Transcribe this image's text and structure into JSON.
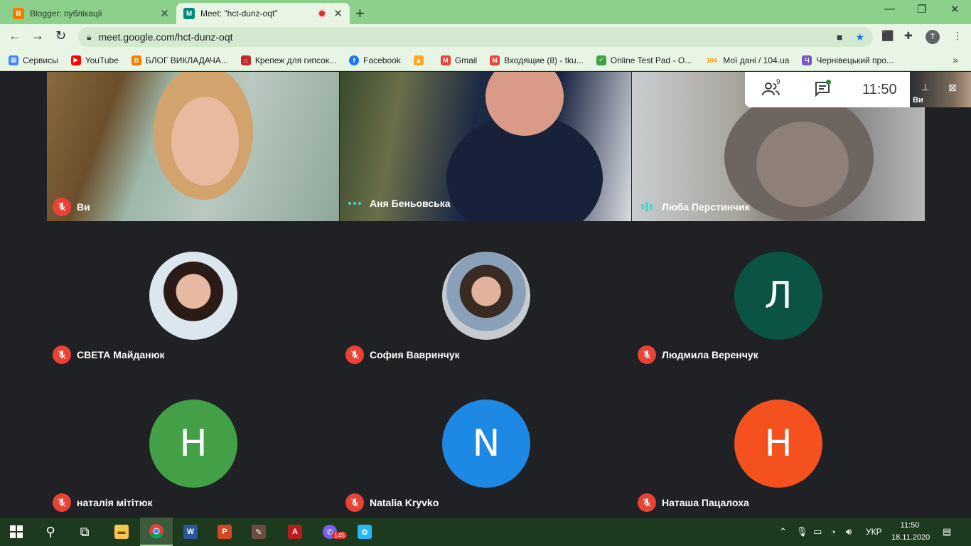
{
  "browser": {
    "tabs": [
      {
        "title": "Blogger: публікації",
        "favicon": "B",
        "color": "#f57c00"
      },
      {
        "title": "Meet: \"hct-dunz-oqt\"",
        "favicon": "M",
        "color": "#00897b"
      }
    ],
    "url": "meet.google.com/hct-dunz-oqt",
    "profile_initial": "T"
  },
  "bookmarks": [
    {
      "label": "Сервисы",
      "icon": "apps-grid-icon",
      "color": "#4285f4",
      "glyph": "▦"
    },
    {
      "label": "YouTube",
      "icon": "youtube-icon",
      "color": "#ff0000",
      "glyph": "▶"
    },
    {
      "label": "БЛОГ ВИКЛАДАЧА...",
      "icon": "blogger-icon",
      "color": "#f57c00",
      "glyph": "B"
    },
    {
      "label": "Крепеж для гипсок...",
      "icon": "house-icon",
      "color": "#c62828",
      "glyph": "⌂"
    },
    {
      "label": "Facebook",
      "icon": "facebook-icon",
      "color": "#1877f2",
      "glyph": "f"
    },
    {
      "label": "",
      "icon": "bell-icon",
      "color": "#f9a825",
      "glyph": "▲"
    },
    {
      "label": "Gmail",
      "icon": "gmail-icon",
      "color": "#ea4335",
      "glyph": "M"
    },
    {
      "label": "Входящие (8) - tku...",
      "icon": "gmail-icon",
      "color": "#ea4335",
      "glyph": "M"
    },
    {
      "label": "Online Test Pad - O...",
      "icon": "testpad-icon",
      "color": "#43a047",
      "glyph": "✓"
    },
    {
      "label": "Мої дані / 104.ua",
      "icon": "104-icon",
      "color": "#ff9800",
      "glyph": "104"
    },
    {
      "label": "Чернівецький про...",
      "icon": "region-icon",
      "color": "#7e57c2",
      "glyph": "Ч"
    }
  ],
  "meet": {
    "participant_count": "9",
    "time": "11:50",
    "self_label": "Ви",
    "video_tiles": [
      {
        "name": "Ви",
        "state": "muted"
      },
      {
        "name": "Аня Беньовська",
        "state": "dots"
      },
      {
        "name": "Люба Перстинчик",
        "state": "speaking"
      }
    ],
    "avatar_tiles": [
      {
        "name": "СВЕТА Майданюк",
        "initial": "",
        "color": "photo1"
      },
      {
        "name": "София Вавринчук",
        "initial": "",
        "color": "photo2"
      },
      {
        "name": "Людмила Веренчук",
        "initial": "Л",
        "color": "#0b5345"
      },
      {
        "name": "наталія мітітюк",
        "initial": "Н",
        "color": "#43a047"
      },
      {
        "name": "Natalia Kryvko",
        "initial": "N",
        "color": "#1e88e5"
      },
      {
        "name": "Наташа Пацалоха",
        "initial": "Н",
        "color": "#f4511e"
      }
    ]
  },
  "taskbar": {
    "viber_badge": "145",
    "language": "УКР",
    "time": "11:50",
    "date": "18.11.2020"
  }
}
